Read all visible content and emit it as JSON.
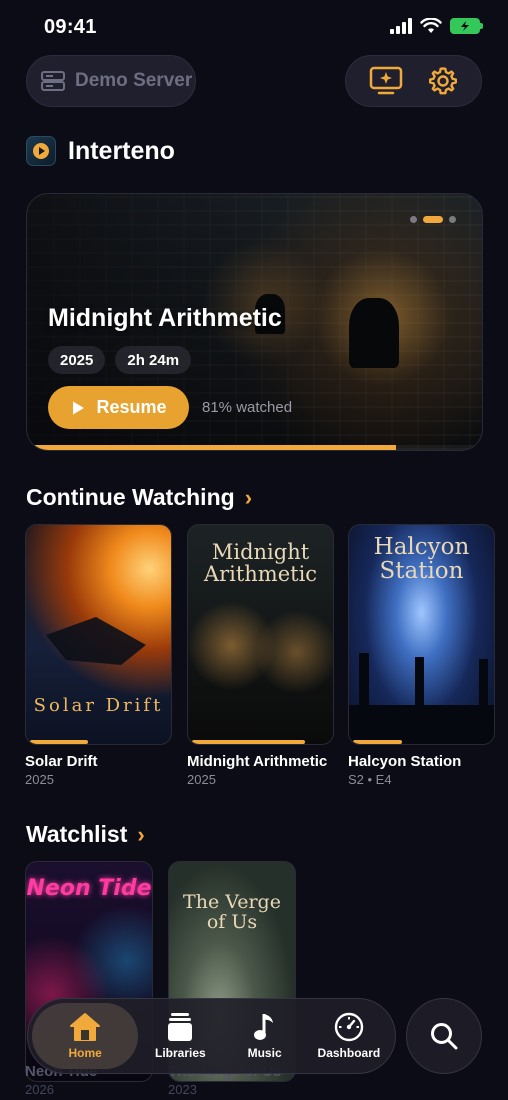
{
  "status_bar": {
    "time": "09:41"
  },
  "top_bar": {
    "server_label": "Demo Server"
  },
  "app": {
    "title": "Interteno"
  },
  "hero": {
    "title": "Midnight Arithmetic",
    "year": "2025",
    "duration": "2h 24m",
    "resume_label": "Resume",
    "watched_text": "81% watched",
    "progress": 0.81,
    "carousel_pages": 3,
    "carousel_active": 1
  },
  "continue_watching": {
    "title": "Continue Watching",
    "items": [
      {
        "title": "Solar Drift",
        "subtitle": "2025",
        "poster_text": "Solar Drift",
        "progress": 0.42
      },
      {
        "title": "Midnight Arithmetic",
        "subtitle": "2025",
        "poster_text": "Midnight Arithmetic",
        "progress": 0.81
      },
      {
        "title": "Halcyon Station",
        "subtitle": "S2 • E4",
        "poster_text": "Halcyon Station",
        "progress": 0.35
      }
    ]
  },
  "watchlist": {
    "title": "Watchlist",
    "items": [
      {
        "title": "Neon Tide",
        "subtitle": "2026",
        "poster_text": "Neon Tide"
      },
      {
        "title": "The Verge of Us",
        "subtitle": "2023",
        "poster_text": "The Verge of Us"
      }
    ]
  },
  "nav": {
    "items": [
      {
        "label": "Home",
        "icon": "home-icon",
        "active": true
      },
      {
        "label": "Libraries",
        "icon": "libraries-icon",
        "active": false
      },
      {
        "label": "Music",
        "icon": "music-note-icon",
        "active": false
      },
      {
        "label": "Dashboard",
        "icon": "dashboard-gauge-icon",
        "active": false
      }
    ]
  },
  "colors": {
    "accent": "#f0a93a",
    "background": "#0c0c16"
  }
}
